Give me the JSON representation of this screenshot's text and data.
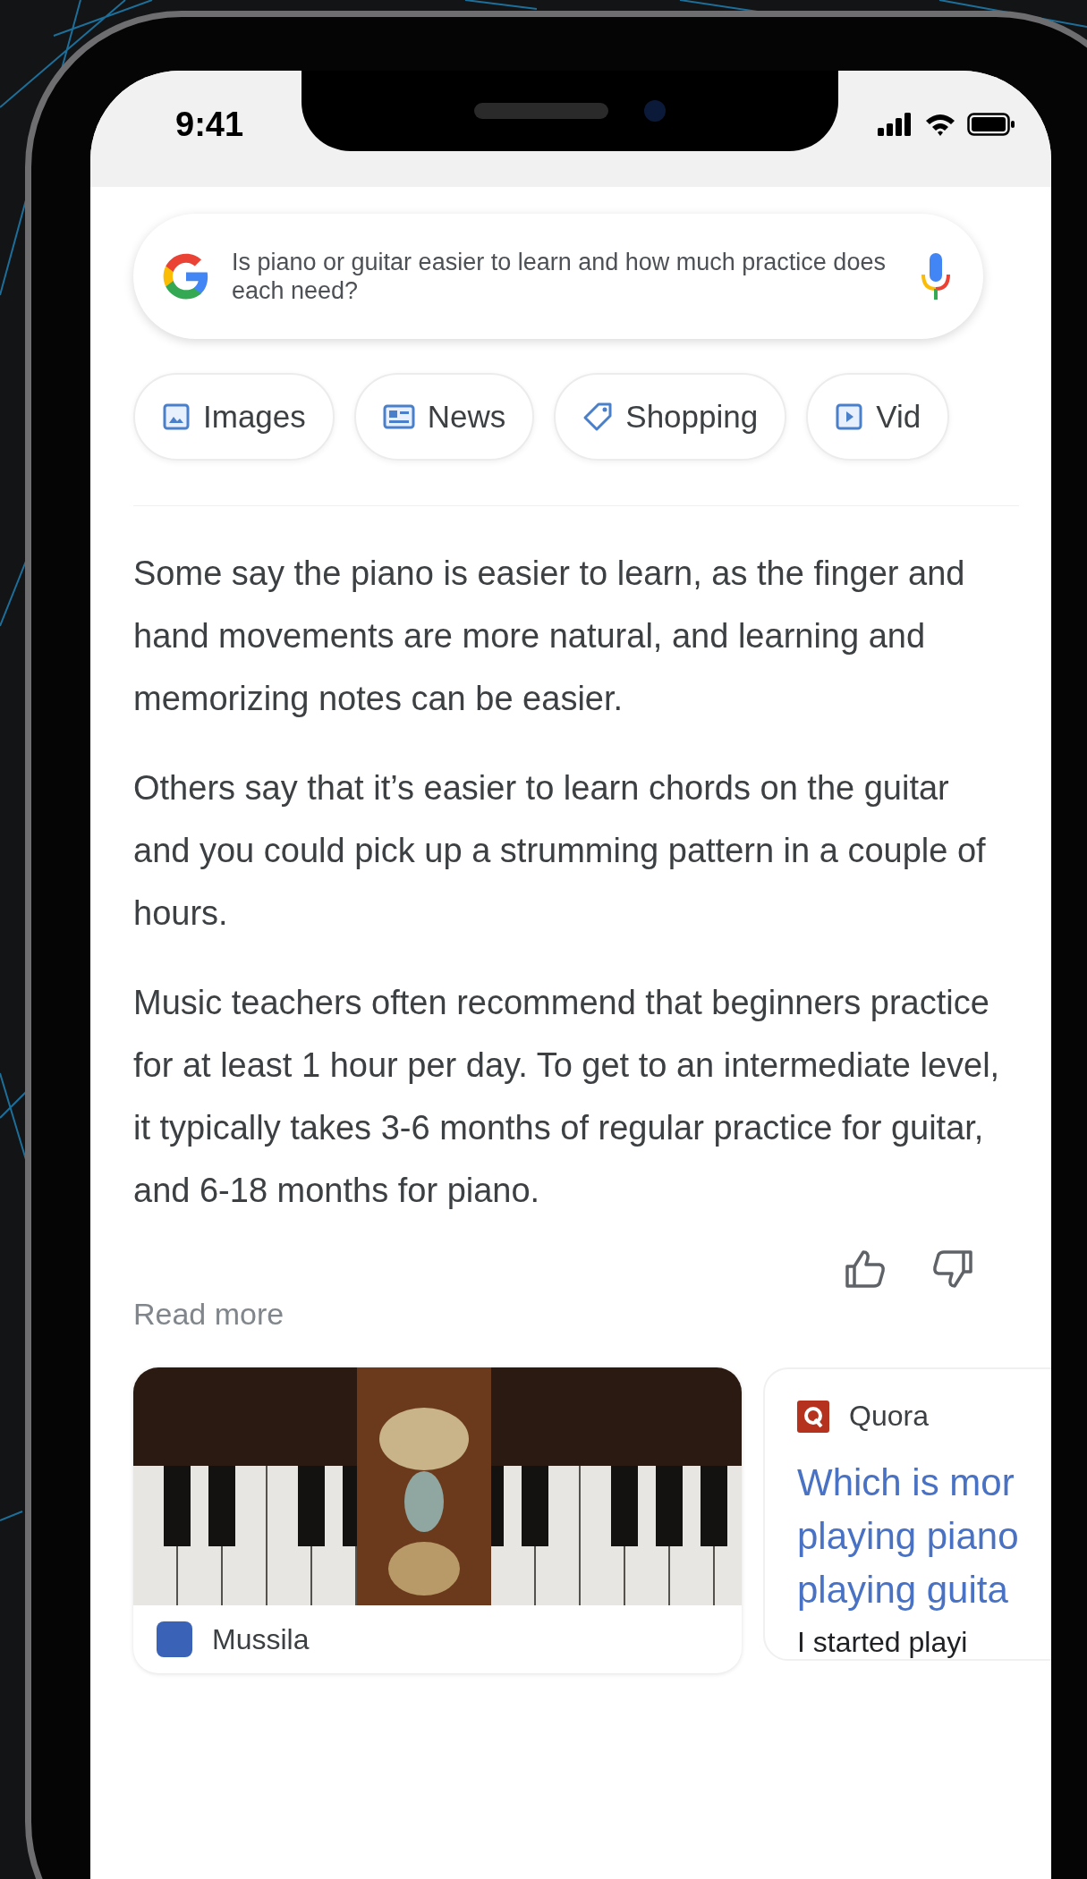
{
  "status_bar": {
    "time": "9:41"
  },
  "search": {
    "query": "Is piano or guitar easier to learn and how much practice does each need?"
  },
  "chips": [
    {
      "label": "Images",
      "kind": "images"
    },
    {
      "label": "News",
      "kind": "news"
    },
    {
      "label": "Shopping",
      "kind": "shopping"
    },
    {
      "label": "Vid",
      "kind": "videos"
    }
  ],
  "answer": {
    "paragraphs": [
      "Some say the piano is easier to learn, as the finger and hand movements are more natural, and learning and memorizing notes can be easier.",
      "Others say that it’s easier to learn chords on the guitar and you could pick up a strumming pattern in a couple of hours.",
      "Music teachers often recommend that beginners practice for at least 1 hour per day. To get to an intermediate level, it typically takes 3-6 months of regular practice for guitar, and 6-18 months for piano."
    ],
    "read_more": "Read more"
  },
  "sources": [
    {
      "kind": "image_card",
      "site": "Mussila"
    },
    {
      "kind": "text_card",
      "site": "Quora",
      "title_lines": [
        "Which is mor",
        "playing piano",
        "playing guita"
      ],
      "snippet": "I started playi"
    }
  ]
}
